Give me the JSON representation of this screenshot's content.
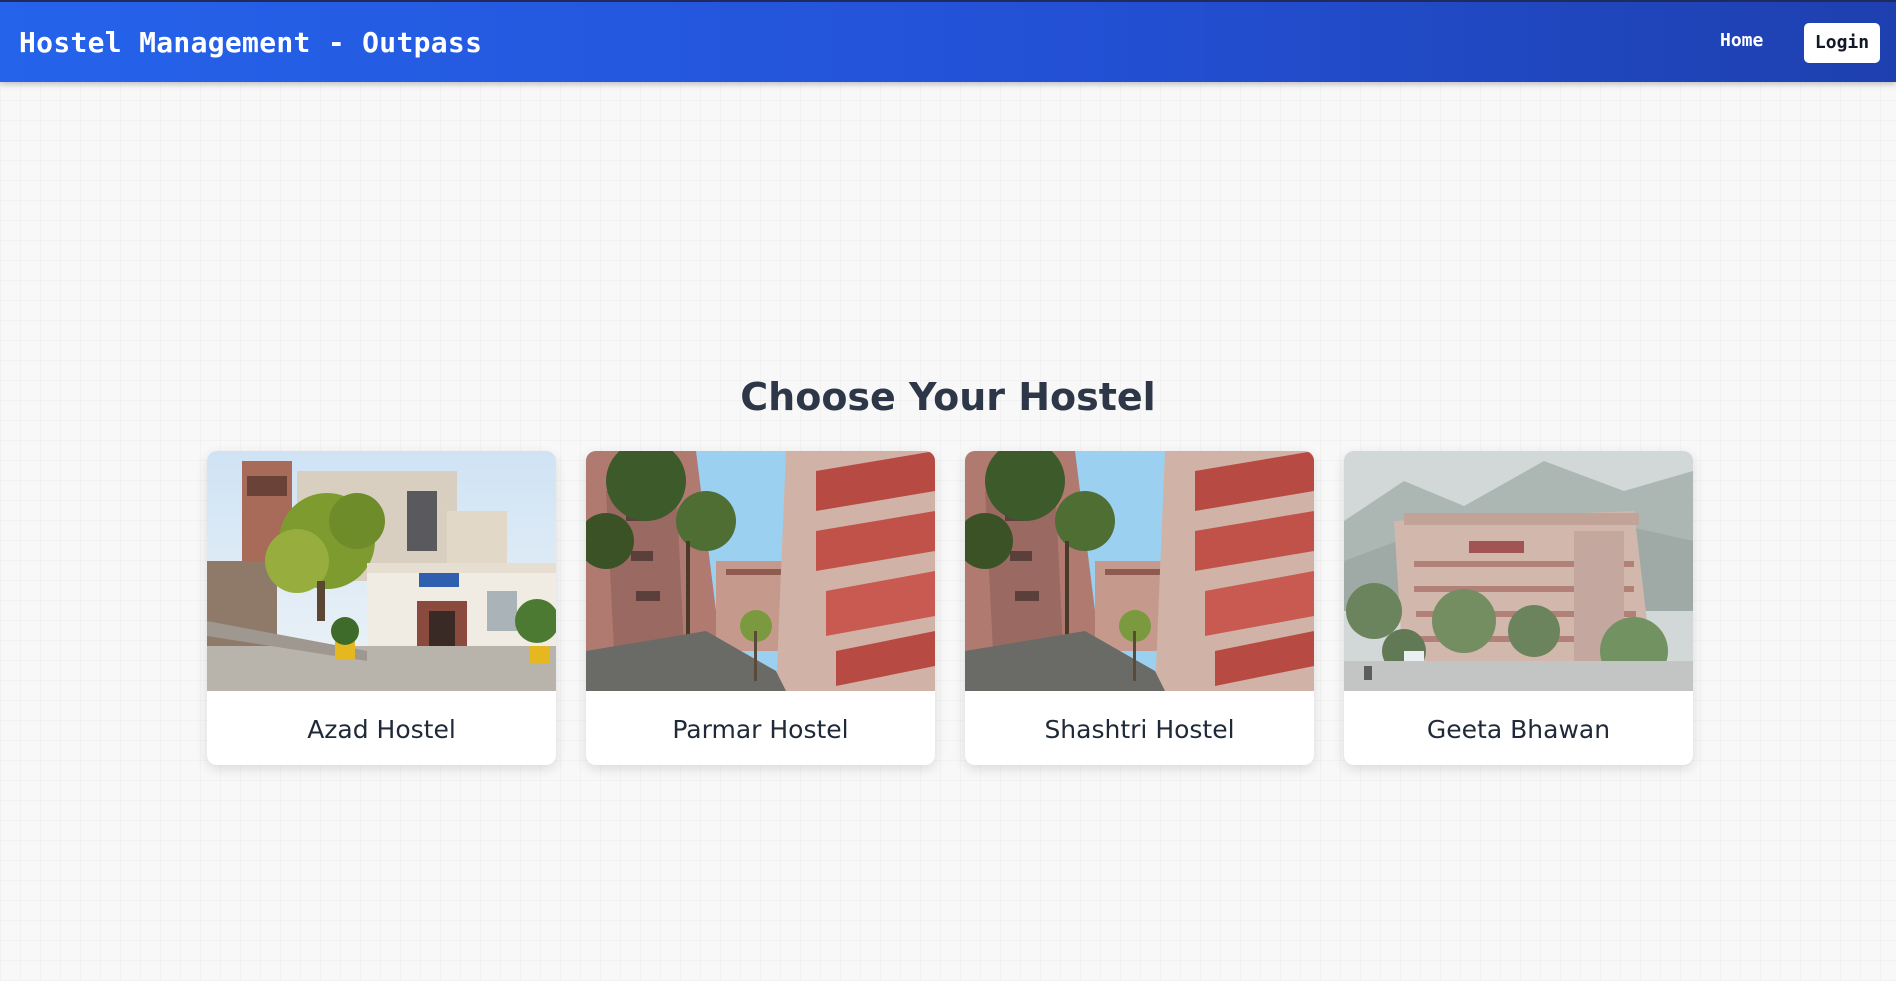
{
  "header": {
    "title": "Hostel Management - Outpass",
    "nav": {
      "home": "Home",
      "login": "Login"
    }
  },
  "main": {
    "heading": "Choose Your Hostel",
    "hostels": [
      {
        "name": "Azad Hostel",
        "image": "hostel-building-photo"
      },
      {
        "name": "Parmar Hostel",
        "image": "hostel-courtyard-photo"
      },
      {
        "name": "Shashtri Hostel",
        "image": "hostel-courtyard-photo"
      },
      {
        "name": "Geeta Bhawan",
        "image": "hostel-hillside-photo"
      }
    ]
  },
  "colors": {
    "header_gradient_start": "#2563eb",
    "header_gradient_end": "#1e40af",
    "heading_text": "#2d3748"
  }
}
